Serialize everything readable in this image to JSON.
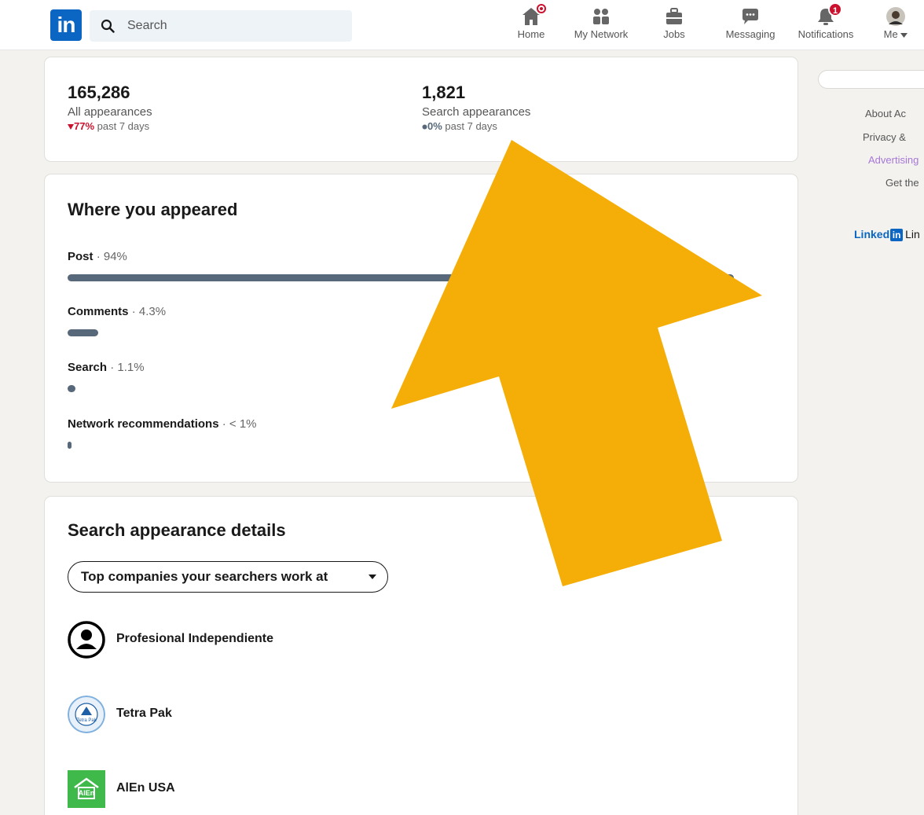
{
  "colors": {
    "linkedin_blue": "#0a66c2",
    "badge_red": "#cb112d",
    "bar_slate": "#56687a",
    "page_bg": "#f3f2ee",
    "overlay_arrow": "#f5ae08"
  },
  "nav": {
    "logo": "in",
    "search": {
      "placeholder": "Search",
      "icon": "search-icon"
    },
    "items": [
      {
        "label": "Home",
        "icon": "home-icon",
        "badge_dot": true
      },
      {
        "label": "My Network",
        "icon": "people-icon"
      },
      {
        "label": "Jobs",
        "icon": "briefcase-icon"
      },
      {
        "label": "Messaging",
        "icon": "chat-icon"
      },
      {
        "label": "Notifications",
        "icon": "bell-icon",
        "badge": "1"
      },
      {
        "label": "Me",
        "icon": "avatar-icon"
      }
    ]
  },
  "stats": {
    "all": {
      "value": "165,286",
      "label": "All appearances",
      "change": "77%",
      "change_direction": "down",
      "period": "past 7 days"
    },
    "search": {
      "value": "1,821",
      "label": "Search appearances",
      "change": "0%",
      "change_direction": "flat",
      "period": "past 7 days"
    }
  },
  "where": {
    "title": "Where you appeared",
    "separator": "·",
    "rows": [
      {
        "name": "Post",
        "value": "94%",
        "share": 0.94
      },
      {
        "name": "Comments",
        "value": "4.3%",
        "share": 0.043
      },
      {
        "name": "Search",
        "value": "1.1%",
        "share": 0.011
      },
      {
        "name": "Network recommendations",
        "value": "< 1%",
        "share": 0.005
      }
    ]
  },
  "details": {
    "title": "Search appearance details",
    "dropdown_label": "Top companies your searchers work at",
    "companies": [
      {
        "name": "Profesional Independiente",
        "logo": "person-icon"
      },
      {
        "name": "Tetra Pak",
        "logo": "tetra-pak-logo",
        "logo_text": "Tetra Pak"
      },
      {
        "name": "AlEn USA",
        "logo": "alen-logo",
        "logo_text": "AlEn"
      }
    ]
  },
  "rail": {
    "links": [
      "About  Ac",
      "Privacy &",
      "Advertising",
      "Get the"
    ],
    "brand": {
      "word": "Linked",
      "box": "in",
      "rest": "Lin"
    }
  }
}
